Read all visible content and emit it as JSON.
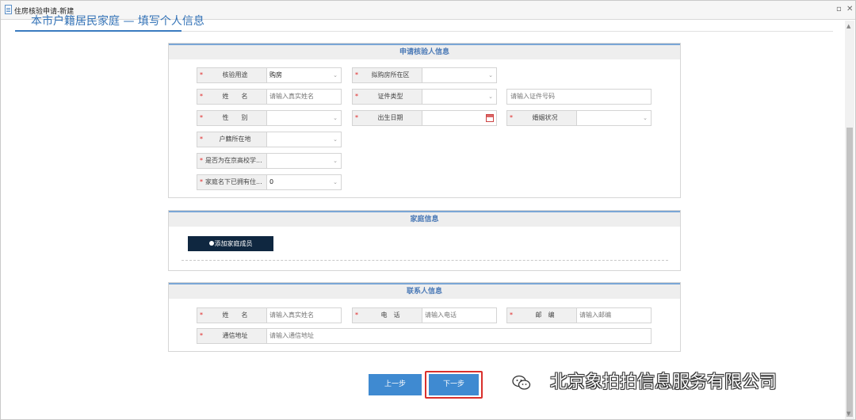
{
  "window": {
    "title": "住房核验申请-新建",
    "restore_glyph": "▫",
    "close_glyph": "✕"
  },
  "page": {
    "section_title": "本市户籍居民家庭 — 填写个人信息"
  },
  "applicant_panel": {
    "header": "申请核验人信息",
    "fields": {
      "purpose": {
        "label": "核验用途",
        "value": "购房"
      },
      "district": {
        "label": "拟购房所在区",
        "value": ""
      },
      "name": {
        "label": "姓　　名",
        "placeholder": "请输入真实姓名"
      },
      "id_type": {
        "label": "证件类型",
        "value": ""
      },
      "id_number": {
        "placeholder": "请输入证件号码"
      },
      "gender": {
        "label": "性　　别",
        "value": ""
      },
      "birth_date": {
        "label": "出生日期",
        "value": ""
      },
      "marital_status": {
        "label": "婚姻状况",
        "value": ""
      },
      "hukou_location": {
        "label": "户籍所在地",
        "value": ""
      },
      "student": {
        "label": "是否为在京高校学...",
        "value": ""
      },
      "owned_homes": {
        "label": "家庭名下已拥有住...",
        "value": "0"
      }
    }
  },
  "family_panel": {
    "header": "家庭信息",
    "add_member_label": "添加家庭成员"
  },
  "contact_panel": {
    "header": "联系人信息",
    "fields": {
      "name": {
        "label": "姓　　名",
        "placeholder": "请输入真实姓名"
      },
      "phone": {
        "label": "电　话",
        "placeholder": "请输入电话"
      },
      "postcode": {
        "label": "邮　编",
        "placeholder": "请输入邮编"
      },
      "address": {
        "label": "通信地址",
        "placeholder": "请输入通信地址"
      }
    }
  },
  "nav": {
    "prev_label": "上一步",
    "next_label": "下一步"
  },
  "watermark": {
    "text": "北京象拍拍信息服务有限公司"
  },
  "glyphs": {
    "required": "*",
    "dropdown": "⌄"
  },
  "colors": {
    "accent": "#3f8ad1",
    "highlight_border": "#d9302c",
    "required": "#e02424"
  }
}
